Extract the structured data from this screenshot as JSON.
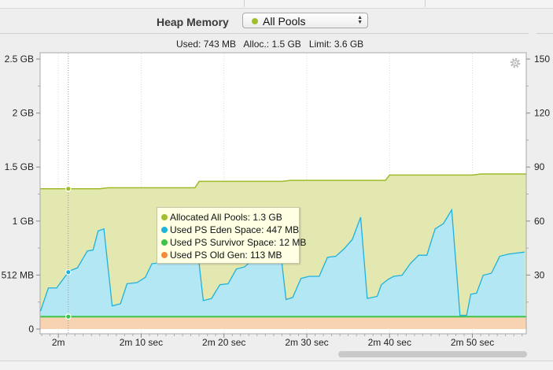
{
  "header": {
    "title": "Heap Memory",
    "pool_selector": {
      "value": "All Pools",
      "dot_color": "#9fbf2f"
    }
  },
  "stats": {
    "used_label": "Used:",
    "used": "743 MB",
    "alloc_label": "Alloc.:",
    "alloc": "1.5 GB",
    "limit_label": "Limit:",
    "limit": "3.6 GB"
  },
  "tooltip": [
    {
      "label": "Allocated All Pools: 1.3 GB",
      "color": "#9fbf2f"
    },
    {
      "label": "Used PS Eden Space: 447 MB",
      "color": "#22b3dc"
    },
    {
      "label": "Used PS Survivor Space: 12 MB",
      "color": "#3fc44a"
    },
    {
      "label": "Used PS Old Gen: 113 MB",
      "color": "#f58a3c"
    }
  ],
  "colors": {
    "allocated_fill": "#e3e7b0",
    "allocated_line": "#9dbb2a",
    "eden_fill": "#b3e7f3",
    "eden_line": "#21b1dc",
    "survivor_line": "#3fc44a",
    "old_fill": "#f8d3b2"
  },
  "icons": {
    "settings": "gear-icon"
  },
  "chart_data": {
    "type": "area",
    "x_unit": "seconds",
    "x_range": [
      117.8,
      176.5
    ],
    "ylim": [
      0,
      2560
    ],
    "y_unit": "MB",
    "y_ticks": [
      {
        "value": 0,
        "label": "0"
      },
      {
        "value": 512,
        "label": "512 MB"
      },
      {
        "value": 1024,
        "label": "1 GB"
      },
      {
        "value": 1536,
        "label": "1.5 GB"
      },
      {
        "value": 2048,
        "label": "2 GB"
      },
      {
        "value": 2560,
        "label": "2.5 GB"
      }
    ],
    "y2lim": [
      0,
      150
    ],
    "y2_ticks": [
      {
        "value": 30,
        "label": "30"
      },
      {
        "value": 60,
        "label": "60"
      },
      {
        "value": 90,
        "label": "90"
      },
      {
        "value": 120,
        "label": "120"
      },
      {
        "value": 150,
        "label": "150"
      }
    ],
    "x_ticks": [
      {
        "value": 120,
        "label": "2m"
      },
      {
        "value": 130,
        "label": "2m 10 sec"
      },
      {
        "value": 140,
        "label": "2m 20 sec"
      },
      {
        "value": 150,
        "label": "2m 30 sec"
      },
      {
        "value": 160,
        "label": "2m 40 sec"
      },
      {
        "value": 170,
        "label": "2m 50 sec"
      }
    ],
    "hover_x": 121.2,
    "series": [
      {
        "name": "Allocated All Pools",
        "x": [
          117.8,
          121.2,
          125.0,
          126.0,
          136.5,
          137.0,
          147.0,
          148.0,
          159.5,
          160.0,
          170.0,
          171.0,
          178.0
        ],
        "values": [
          1330,
          1330,
          1330,
          1340,
          1340,
          1400,
          1400,
          1410,
          1410,
          1460,
          1460,
          1470,
          1470
        ]
      },
      {
        "name": "Used PS Eden Space",
        "x": [
          117.8,
          118.8,
          119.8,
          121.3,
          122.3,
          123.5,
          124.2,
          124.8,
          125.5,
          126.5,
          127.5,
          128.3,
          129.5,
          130.5,
          131.3,
          132.5,
          133.5,
          134.5,
          135.5,
          136.5,
          137.5,
          138.5,
          139.5,
          140.5,
          141.5,
          142.5,
          143.5,
          144.5,
          145.5,
          146.5,
          147.5,
          148.3,
          149.3,
          150.3,
          151.5,
          152.5,
          153.5,
          154.5,
          155.5,
          156.5,
          157.3,
          158.5,
          159.0,
          159.8,
          160.5,
          161.5,
          162.5,
          163.5,
          164.5,
          165.5,
          166.5,
          167.5,
          168.5,
          169.3,
          169.8,
          170.5,
          171.3,
          172.3,
          173.3,
          174.3,
          175.3,
          176.3
        ],
        "values": [
          170,
          390,
          390,
          550,
          580,
          740,
          750,
          930,
          950,
          220,
          240,
          430,
          440,
          490,
          620,
          630,
          710,
          720,
          850,
          970,
          270,
          290,
          420,
          430,
          570,
          590,
          660,
          690,
          850,
          960,
          280,
          300,
          480,
          500,
          500,
          680,
          690,
          760,
          850,
          1060,
          290,
          310,
          420,
          470,
          500,
          510,
          620,
          700,
          700,
          950,
          1000,
          1130,
          130,
          130,
          330,
          340,
          510,
          530,
          690,
          710,
          720,
          730
        ]
      },
      {
        "name": "Used PS Survivor Space",
        "x": [
          117.8,
          121.2,
          178.0
        ],
        "values": [
          118,
          118,
          118
        ]
      },
      {
        "name": "Used PS Old Gen",
        "x": [
          117.8,
          178.0
        ],
        "values": [
          113,
          113
        ]
      }
    ]
  }
}
